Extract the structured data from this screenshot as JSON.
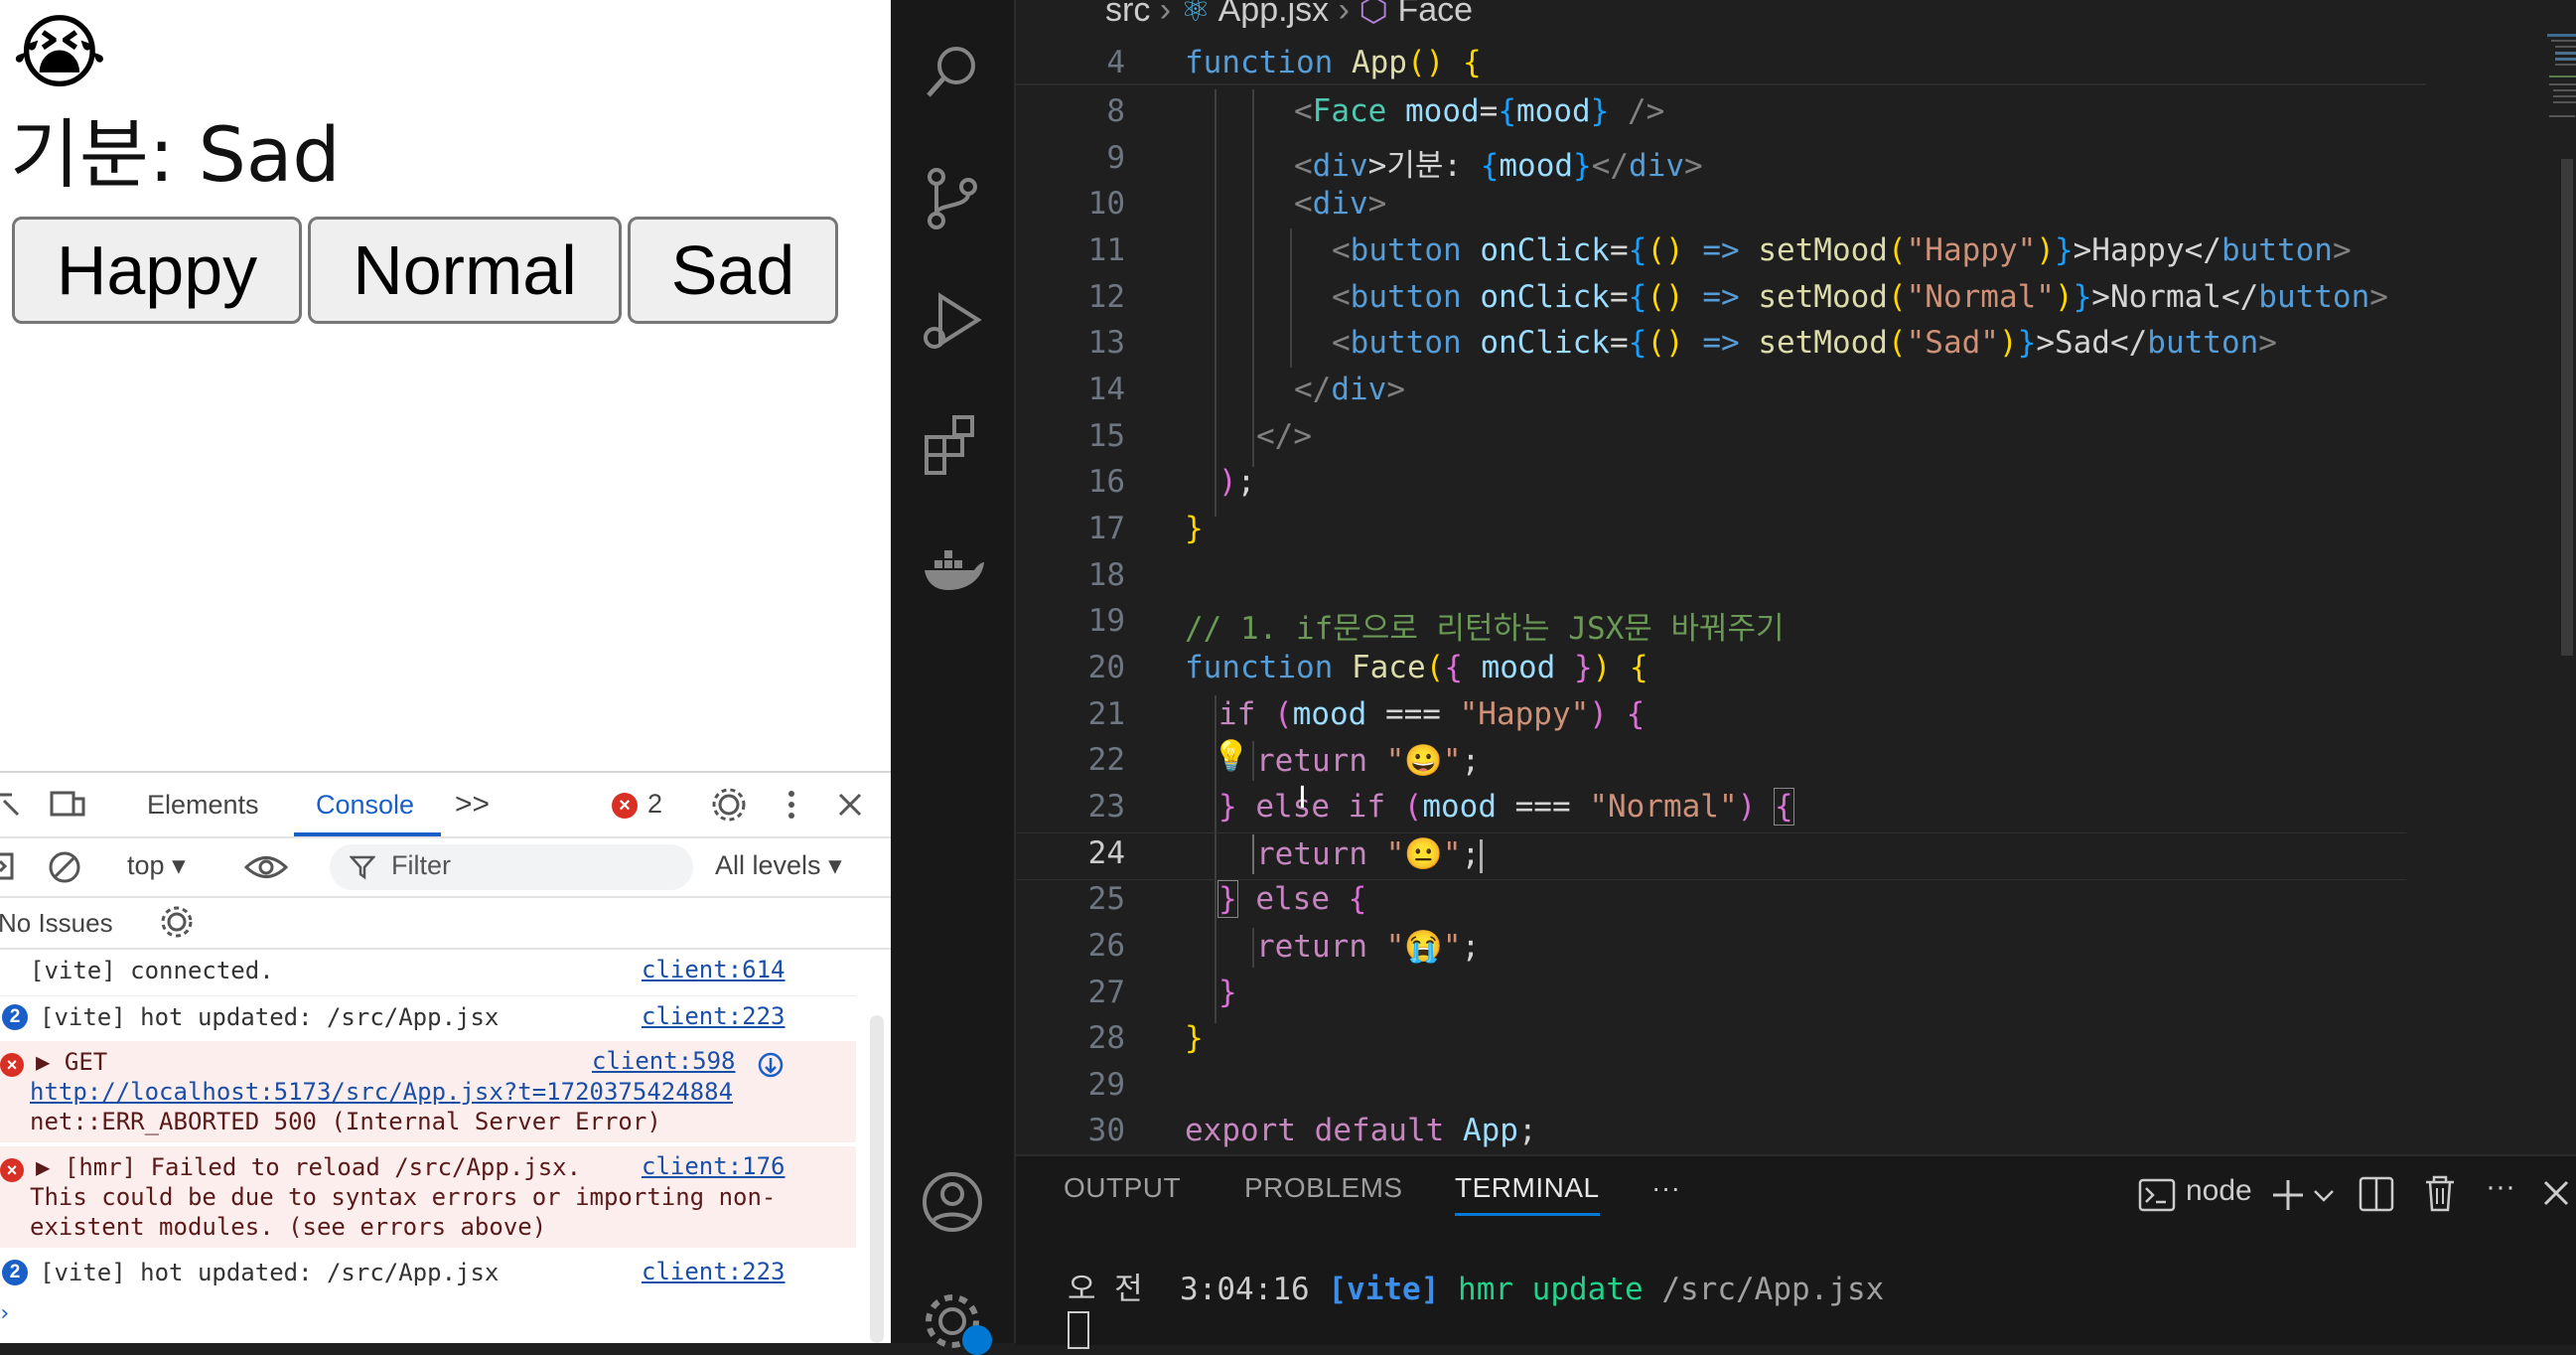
{
  "browser": {
    "face": "😭",
    "mood_label": "기분: ",
    "mood_value": "Sad",
    "buttons": [
      "Happy",
      "Normal",
      "Sad"
    ]
  },
  "devtools": {
    "tabs": {
      "elements": "Elements",
      "console": "Console",
      "more": ">>"
    },
    "error_count": "2",
    "context": "top",
    "filter_placeholder": "Filter",
    "levels": "All levels",
    "issues": "No Issues",
    "logs": [
      {
        "kind": "info",
        "text": "[vite] connected.",
        "source": "client:614"
      },
      {
        "kind": "repeat",
        "count": "2",
        "text": "[vite] hot updated: /src/App.jsx",
        "source": "client:223"
      },
      {
        "kind": "error",
        "lines": [
          "▶ GET",
          "http://localhost:5173/src/App.jsx?t=1720375424884",
          "net::ERR_ABORTED 500 (Internal Server Error)"
        ],
        "source": "client:598"
      },
      {
        "kind": "error",
        "lines": [
          "▶ [hmr] Failed to reload /src/App.jsx.",
          "This could be due to syntax errors or importing non-",
          "existent modules. (see errors above)"
        ],
        "source": "client:176"
      },
      {
        "kind": "repeat",
        "count": "2",
        "text": "[vite] hot updated: /src/App.jsx",
        "source": "client:223"
      }
    ]
  },
  "vscode": {
    "breadcrumb": {
      "folder": "src",
      "file": "App.jsx",
      "symbol": "Face"
    },
    "sticky_line": {
      "num": "4",
      "kw": "function",
      "name": "App",
      "rest": "() {"
    },
    "lines": [
      {
        "num": "8"
      },
      {
        "num": "9"
      },
      {
        "num": "10"
      },
      {
        "num": "11"
      },
      {
        "num": "12"
      },
      {
        "num": "13"
      },
      {
        "num": "14"
      },
      {
        "num": "15"
      },
      {
        "num": "16"
      },
      {
        "num": "17"
      },
      {
        "num": "18"
      },
      {
        "num": "19"
      },
      {
        "num": "20"
      },
      {
        "num": "21"
      },
      {
        "num": "22"
      },
      {
        "num": "23"
      },
      {
        "num": "24"
      },
      {
        "num": "25"
      },
      {
        "num": "26"
      },
      {
        "num": "27"
      },
      {
        "num": "28"
      },
      {
        "num": "29"
      },
      {
        "num": "30"
      }
    ],
    "code": {
      "l8": [
        "<",
        "Face",
        " ",
        "mood",
        "=",
        "{",
        "mood",
        "}",
        " />"
      ],
      "l9": [
        "<",
        "div",
        ">기분: ",
        "{",
        "mood",
        "}",
        "</",
        "div",
        ">"
      ],
      "l10": [
        "<",
        "div",
        ">"
      ],
      "l11": [
        "<",
        "button",
        " ",
        "onClick",
        "=",
        "{",
        "()",
        " => ",
        "setMood",
        "(",
        "\"Happy\"",
        ")",
        "}",
        ">Happy</",
        "button",
        ">"
      ],
      "l12": [
        "<",
        "button",
        " ",
        "onClick",
        "=",
        "{",
        "()",
        " => ",
        "setMood",
        "(",
        "\"Normal\"",
        ")",
        "}",
        ">Normal</",
        "button",
        ">"
      ],
      "l13": [
        "<",
        "button",
        " ",
        "onClick",
        "=",
        "{",
        "()",
        " => ",
        "setMood",
        "(",
        "\"Sad\"",
        ")",
        "}",
        ">Sad</",
        "button",
        ">"
      ],
      "l14": [
        "</",
        "div",
        ">"
      ],
      "l15": [
        "</>"
      ],
      "l16": [
        ")",
        ";"
      ],
      "l17": [
        "}"
      ],
      "l19": [
        "// 1. if문으로 리턴하는 JSX문 바꿔주기"
      ],
      "l20": [
        "function",
        " ",
        "Face",
        "(",
        "{",
        " mood ",
        "}",
        ") ",
        "{"
      ],
      "l21": [
        "if",
        " (",
        "mood",
        " === ",
        "\"Happy\"",
        ") ",
        "{"
      ],
      "l22": [
        "return",
        " ",
        "\"😀\"",
        ";"
      ],
      "l23": [
        "}",
        " ",
        "else",
        " ",
        "if",
        " (",
        "mood",
        " === ",
        "\"Normal\"",
        ") ",
        "{"
      ],
      "l24": [
        "return",
        " ",
        "\"😐\"",
        ";"
      ],
      "l25": [
        "}",
        " ",
        "else",
        " ",
        "{"
      ],
      "l26": [
        "return",
        " ",
        "\"😭\"",
        ";"
      ],
      "l27": [
        "}"
      ],
      "l28": [
        "}"
      ],
      "l30": [
        "export",
        " ",
        "default",
        " ",
        "App",
        ";"
      ]
    },
    "panel": {
      "tabs": [
        "OUTPUT",
        "PROBLEMS",
        "TERMINAL"
      ],
      "more": "···",
      "terminal_name": "node",
      "terminal_line": {
        "ampm": "오 전",
        "time": "3:04:16",
        "tag": "[vite]",
        "msg": "hmr update",
        "path": "/src/App.jsx"
      }
    }
  }
}
